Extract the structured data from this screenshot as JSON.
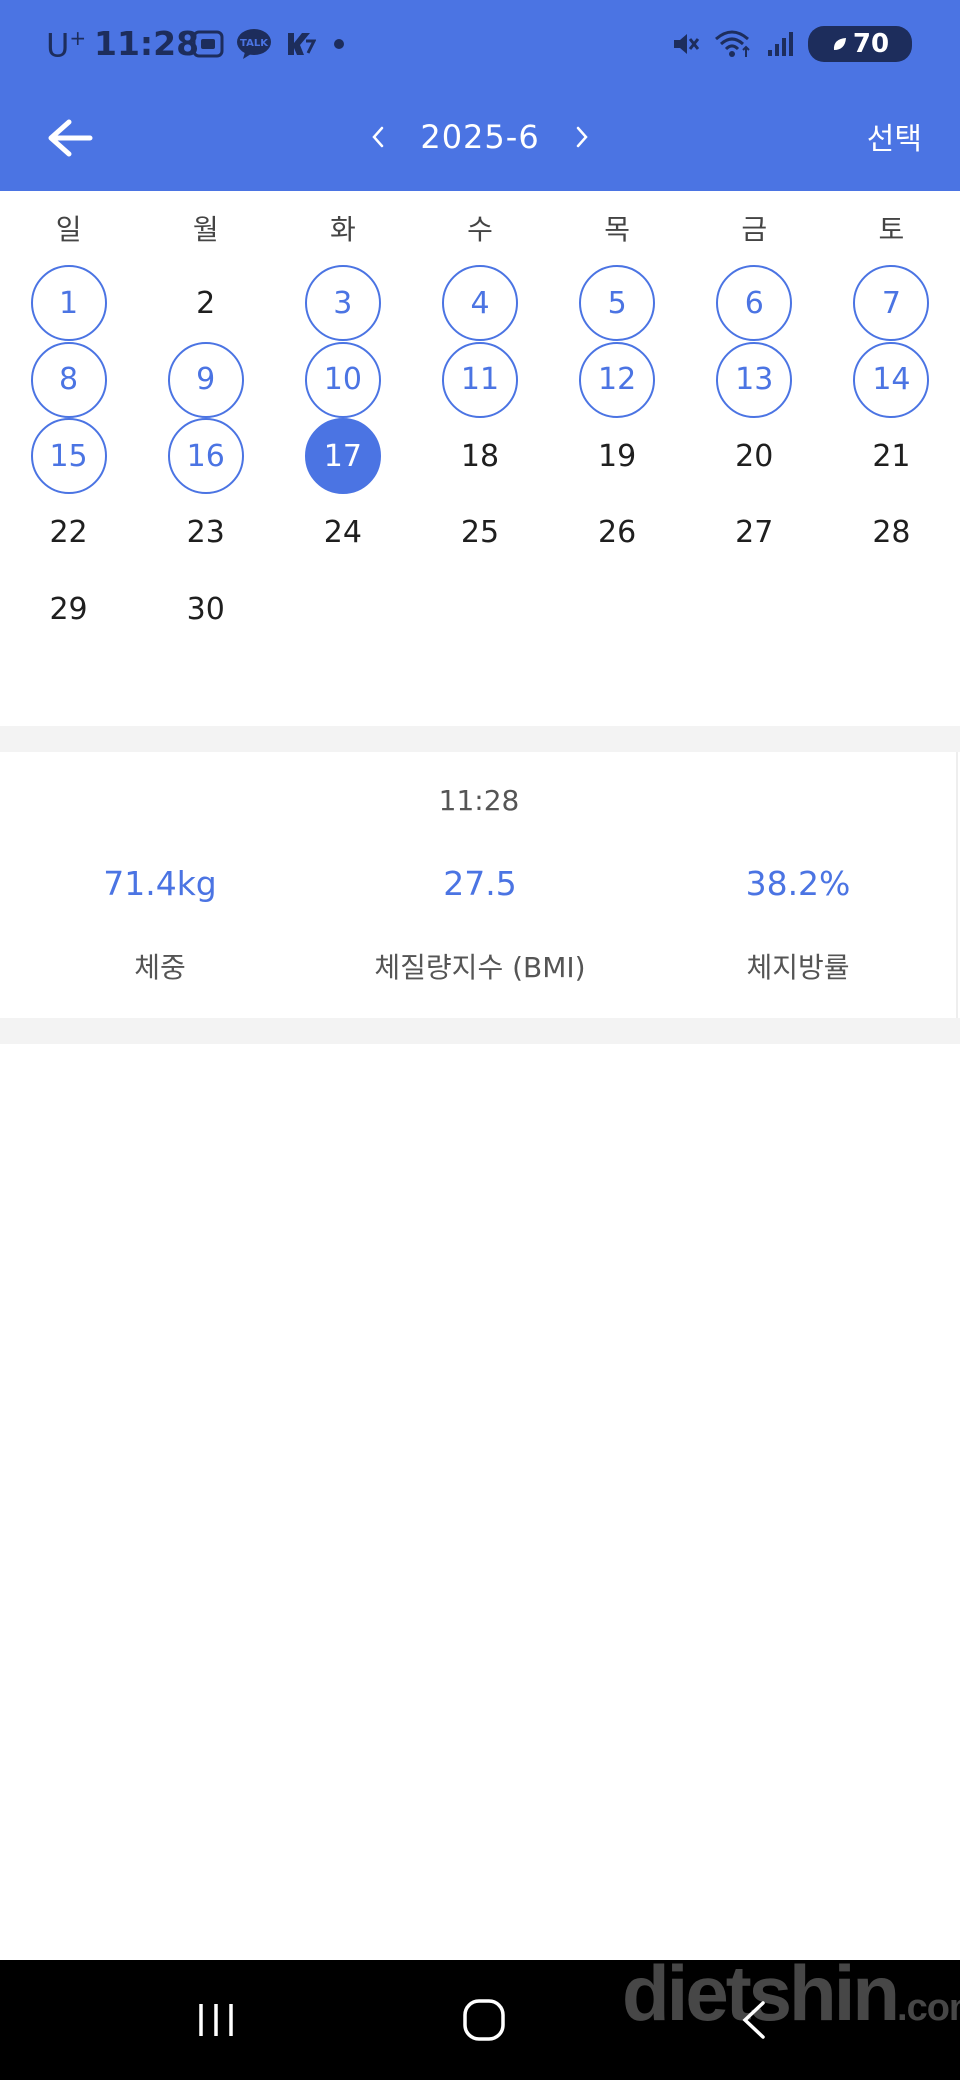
{
  "status_bar": {
    "carrier": "U",
    "carrier_sup": "+",
    "time": "11:28",
    "talk_badge": "TALK",
    "battery": "70",
    "icons": [
      "screenshot-icon",
      "kakaotalk-icon",
      "app-icon",
      "notification-dot",
      "mute-icon",
      "wifi-icon",
      "signal-icon",
      "battery-icon"
    ]
  },
  "app_bar": {
    "month": "2025-6",
    "select_label": "선택",
    "accent_color": "#4b74e3"
  },
  "calendar": {
    "weekdays": [
      "일",
      "월",
      "화",
      "수",
      "목",
      "금",
      "토"
    ],
    "weeks": [
      [
        {
          "day": "1",
          "state": "recorded"
        },
        {
          "day": "2",
          "state": "plain"
        },
        {
          "day": "3",
          "state": "recorded"
        },
        {
          "day": "4",
          "state": "recorded"
        },
        {
          "day": "5",
          "state": "recorded"
        },
        {
          "day": "6",
          "state": "recorded"
        },
        {
          "day": "7",
          "state": "recorded"
        }
      ],
      [
        {
          "day": "8",
          "state": "recorded"
        },
        {
          "day": "9",
          "state": "recorded"
        },
        {
          "day": "10",
          "state": "recorded"
        },
        {
          "day": "11",
          "state": "recorded"
        },
        {
          "day": "12",
          "state": "recorded"
        },
        {
          "day": "13",
          "state": "recorded"
        },
        {
          "day": "14",
          "state": "recorded"
        }
      ],
      [
        {
          "day": "15",
          "state": "recorded"
        },
        {
          "day": "16",
          "state": "recorded"
        },
        {
          "day": "17",
          "state": "selected"
        },
        {
          "day": "18",
          "state": "plain"
        },
        {
          "day": "19",
          "state": "plain"
        },
        {
          "day": "20",
          "state": "plain"
        },
        {
          "day": "21",
          "state": "plain"
        }
      ],
      [
        {
          "day": "22",
          "state": "plain"
        },
        {
          "day": "23",
          "state": "plain"
        },
        {
          "day": "24",
          "state": "plain"
        },
        {
          "day": "25",
          "state": "plain"
        },
        {
          "day": "26",
          "state": "plain"
        },
        {
          "day": "27",
          "state": "plain"
        },
        {
          "day": "28",
          "state": "plain"
        }
      ],
      [
        {
          "day": "29",
          "state": "plain"
        },
        {
          "day": "30",
          "state": "plain"
        }
      ]
    ]
  },
  "summary": {
    "time": "11:28",
    "metrics": [
      {
        "value": "71.4kg",
        "label": "체중"
      },
      {
        "value": "27.5",
        "label": "체질량지수 (BMI)"
      },
      {
        "value": "38.2%",
        "label": "체지방률"
      }
    ]
  },
  "watermark": {
    "brand": "dietshin",
    "suffix": ".com"
  }
}
